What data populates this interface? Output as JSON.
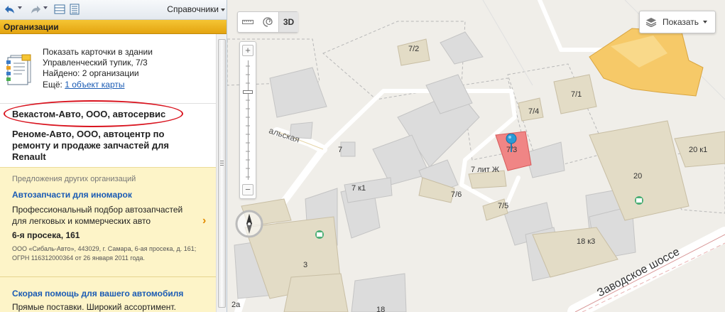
{
  "toolbar": {
    "catalog_label": "Справочники"
  },
  "panel": {
    "title": "Организации"
  },
  "building": {
    "title": "Показать карточки в здании",
    "address": "Управленческий тупик, 7/3",
    "found": "Найдено: 2 организации",
    "more_prefix": "Ещё: ",
    "more_link": "1 объект карты"
  },
  "organizations": [
    "Векастом-Авто, ООО, автосервис",
    "Реноме-Авто, ООО, автоцентр по ремонту и продаже запчастей для Renault"
  ],
  "ads": {
    "section_title": "Предложения других организаций",
    "items": [
      {
        "title": "Автозапчасти для иномарок",
        "description": "Профессиональный подбор автозапчастей для легковых и коммерческих авто",
        "address": "6-я просека, 161",
        "legal": "ООО «Сибаль-Авто», 443029, г. Самара, 6-ая просека, д. 161; ОГРН 116312000364 от 26 января 2011 года.",
        "arrow": "›"
      },
      {
        "title": "Скорая помощь для вашего автомобиля",
        "description": "Прямые поставки. Широкий ассортимент."
      }
    ]
  },
  "map": {
    "tool_3d_label": "3D",
    "layers_label": "Показать",
    "zoom_in": "+",
    "zoom_out": "−",
    "labels": {
      "b7_2": "7/2",
      "b7_1": "7/1",
      "b7_4": "7/4",
      "b7_3": "7/3",
      "b7": "7",
      "b7litzh": "7 лит Ж",
      "b7k1": "7 к1",
      "b7_6": "7/6",
      "b7_5": "7/5",
      "b20k1": "20 к1",
      "b20": "20",
      "b18k3": "18 к3",
      "b3": "3",
      "b2a": "2а",
      "b18": "18",
      "street_alskaya": "альская",
      "street_zavodskoe": "Заводское шоссе"
    },
    "colors": {
      "ground": "#f0eee9",
      "building": "#dcdcdc",
      "building_tan": "#e3dcc6",
      "highlight_building": "#f08585",
      "mall": "#f6c968",
      "road": "#ffffff",
      "marker": "#2a9ad6"
    }
  }
}
